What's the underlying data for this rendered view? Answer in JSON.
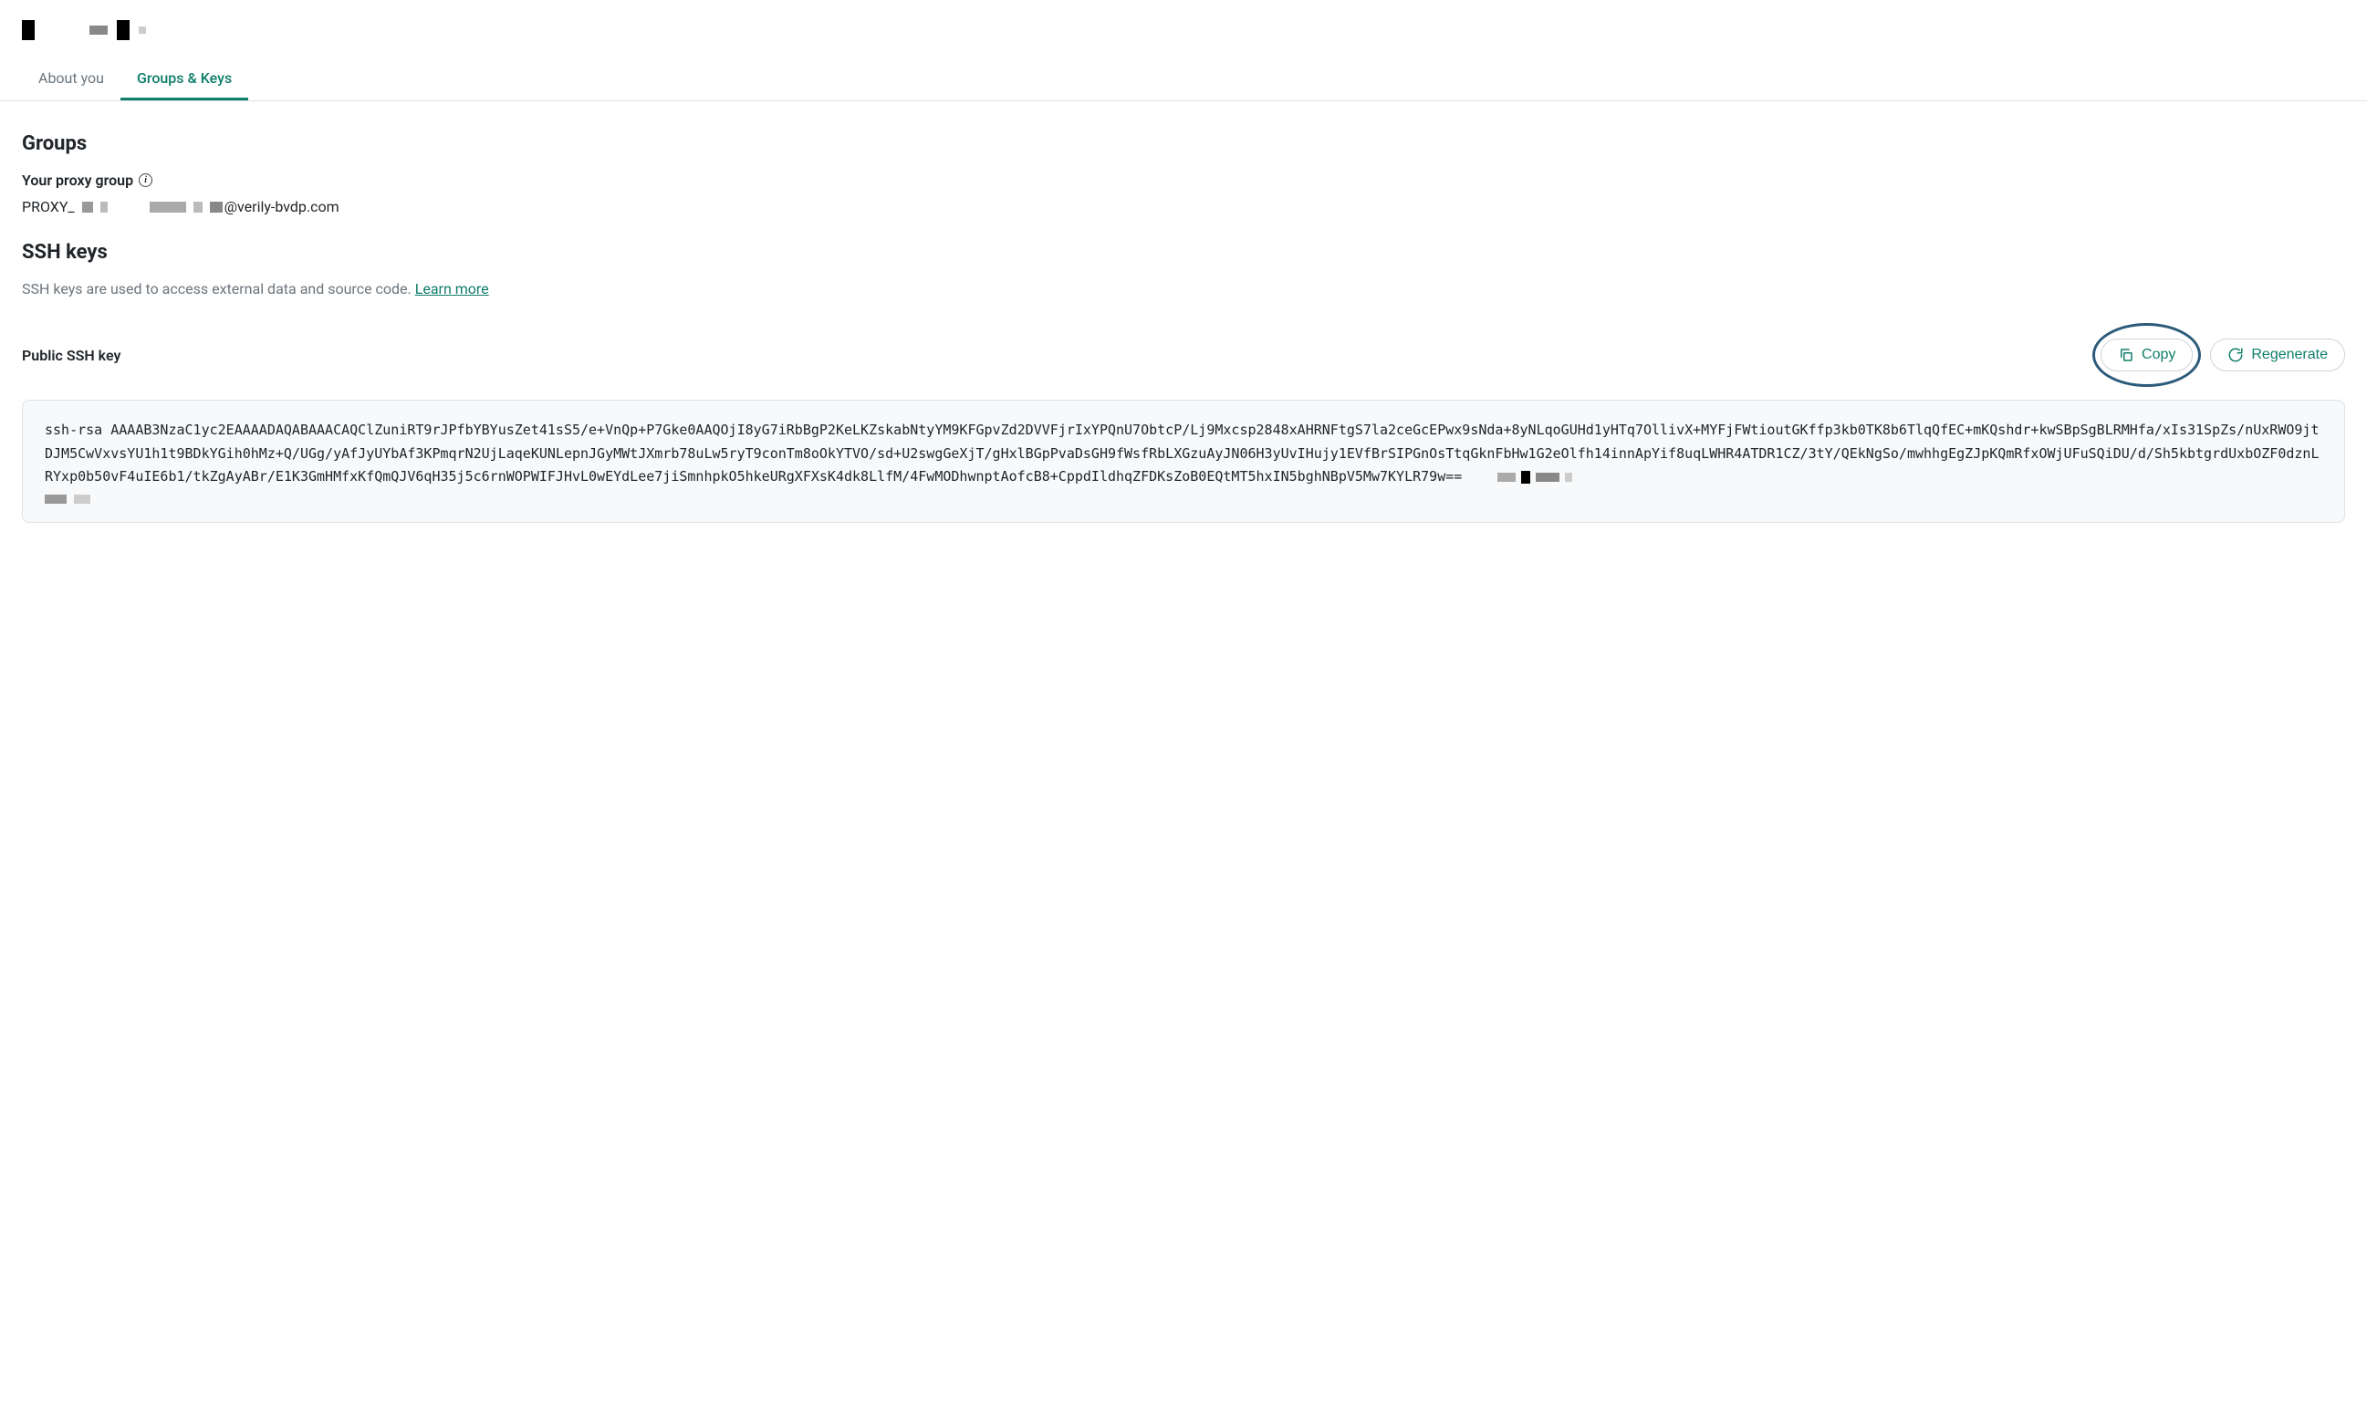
{
  "tabs": {
    "about": "About you",
    "groups": "Groups & Keys"
  },
  "sections": {
    "groups_title": "Groups",
    "proxy_label": "Your proxy group",
    "proxy_prefix": "PROXY_",
    "proxy_suffix": "@verily-bvdp.com",
    "ssh_title": "SSH keys",
    "ssh_desc": "SSH keys are used to access external data and source code. ",
    "learn_more": "Learn more",
    "public_key_label": "Public SSH key"
  },
  "buttons": {
    "copy": "Copy",
    "regenerate": "Regenerate"
  },
  "ssh_key": "ssh-rsa AAAAB3NzaC1yc2EAAAADAQABAAACAQClZuniRT9rJPfbYBYusZet41sS5/e+VnQp+P7Gke0AAQOjI8yG7iRbBgP2KeLKZskabNtyYM9KFGpvZd2DVVFjrIxYPQnU7ObtcP/Lj9Mxcsp2848xAHRNFtgS7la2ceGcEPwx9sNda+8yNLqoGUHd1yHTq7OllivX+MYFjFWtioutGKffp3kb0TK8b6TlqQfEC+mKQshdr+kwSBpSgBLRMHfa/xIs31SpZs/nUxRWO9jtDJM5CwVxvsYU1h1t9BDkYGih0hMz+Q/UGg/yAfJyUYbAf3KPmqrN2UjLaqeKUNLepnJGyMWtJXmrb78uLw5ryT9conTm8oOkYTVO/sd+U2swgGeXjT/gHxlBGpPvaDsGH9fWsfRbLXGzuAyJN06H3yUvIHujy1EVfBrSIPGnOsTtqGknFbHw1G2eOlfh14innApYif8uqLWHR4ATDR1CZ/3tY/QEkNgSo/mwhhgEgZJpKQmRfxOWjUFuSQiDU/d/Sh5kbtgrdUxbOZF0dznLRYxp0b50vF4uIE6b1/tkZgAyABr/E1K3GmHMfxKfQmQJV6qH35j5c6rnWOPWIFJHvL0wEYdLee7jiSmnhpkO5hkeURgXFXsK4dk8LlfM/4FwMODhwnptAofcB8+CppdIldhqZFDKsZoB0EQtMT5hxIN5bghNBpV5Mw7KYLR79w=="
}
